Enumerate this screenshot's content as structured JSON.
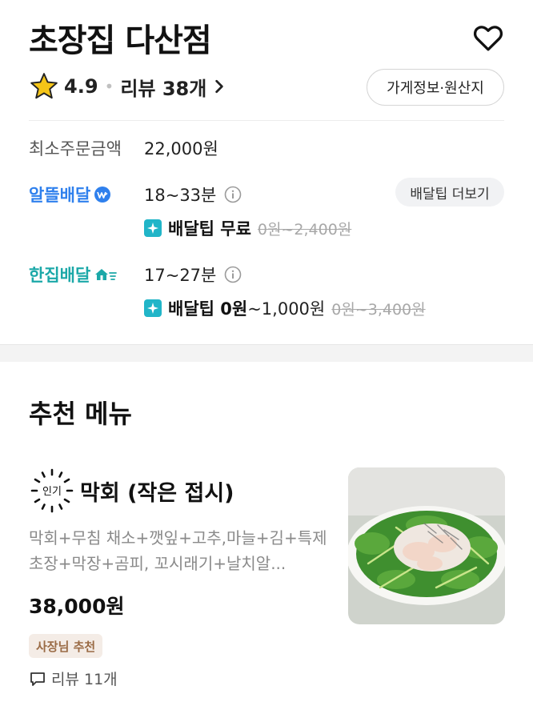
{
  "store": {
    "name": "초장집 다산점",
    "rating": "4.9",
    "review_summary": "리뷰 38개",
    "info_button": "가게정보·원산지"
  },
  "min_order": {
    "label": "최소주문금액",
    "value": "22,000원"
  },
  "delivery_options": [
    {
      "brand": "알뜰배달",
      "brand_color": "#2f80ed",
      "time": "18~33분",
      "tip_label": "배달팁 무료",
      "tip_extra": "",
      "tip_original": "0원~2,400원"
    },
    {
      "brand": "한집배달",
      "brand_color": "#1ba8a8",
      "time": "17~27분",
      "tip_label": "배달팁 0원",
      "tip_extra": "~1,000원",
      "tip_original": "0원~3,400원"
    }
  ],
  "tip_more_button": "배달팁 더보기",
  "recommend": {
    "title": "추천 메뉴",
    "items": [
      {
        "badge": "인기",
        "name": "막회 (작은 접시)",
        "description": "막회+무침 채소+깻잎+고추,마늘+김+특제 초장+막장+곰피, 꼬시래기+날치알...",
        "price": "38,000원",
        "owner_badge": "사장님 추천",
        "reviews": "리뷰 11개"
      }
    ]
  },
  "colors": {
    "accent_blue": "#2f80ed",
    "accent_teal": "#1ba8a8",
    "star": "#f5c518",
    "spark": "#21b5c8"
  },
  "icons": [
    "heart-icon",
    "star-icon",
    "chevron-right-icon",
    "info-icon",
    "sparkle-icon",
    "speech-bubble-icon"
  ]
}
